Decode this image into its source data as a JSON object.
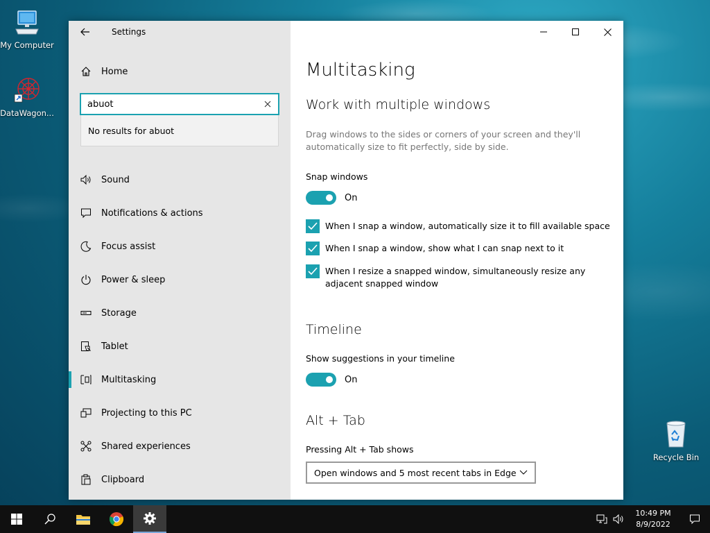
{
  "desktop": {
    "icons": [
      {
        "label": "My Computer",
        "icon": "computer-icon"
      },
      {
        "label": "DataWagon...",
        "icon": "datawagon-icon"
      },
      {
        "label": "Recycle Bin",
        "icon": "recycle-bin-icon"
      }
    ]
  },
  "window": {
    "title": "Settings",
    "home_label": "Home",
    "search": {
      "value": "abuot",
      "no_results": "No results for abuot"
    },
    "nav": [
      {
        "label": "Sound",
        "icon": "speaker-icon"
      },
      {
        "label": "Notifications & actions",
        "icon": "notification-icon"
      },
      {
        "label": "Focus assist",
        "icon": "moon-icon"
      },
      {
        "label": "Power & sleep",
        "icon": "power-icon"
      },
      {
        "label": "Storage",
        "icon": "storage-icon"
      },
      {
        "label": "Tablet",
        "icon": "tablet-icon"
      },
      {
        "label": "Multitasking",
        "icon": "multitasking-icon",
        "active": true
      },
      {
        "label": "Projecting to this PC",
        "icon": "projecting-icon"
      },
      {
        "label": "Shared experiences",
        "icon": "shared-icon"
      },
      {
        "label": "Clipboard",
        "icon": "clipboard-icon"
      }
    ],
    "accent": "#1ba1b0"
  },
  "main": {
    "title": "Multitasking",
    "snap": {
      "heading": "Work with multiple windows",
      "description": "Drag windows to the sides or corners of your screen and they'll automatically size to fit perfectly, side by side.",
      "label": "Snap windows",
      "toggle_state": "On",
      "options": [
        "When I snap a window, automatically size it to fill available space",
        "When I snap a window, show what I can snap next to it",
        "When I resize a snapped window, simultaneously resize any adjacent snapped window"
      ]
    },
    "timeline": {
      "heading": "Timeline",
      "label": "Show suggestions in your timeline",
      "toggle_state": "On"
    },
    "alttab": {
      "heading": "Alt + Tab",
      "label": "Pressing Alt + Tab shows",
      "selected": "Open windows and 5 most recent tabs in Edge"
    }
  },
  "taskbar": {
    "time": "10:49 PM",
    "date": "8/9/2022"
  }
}
